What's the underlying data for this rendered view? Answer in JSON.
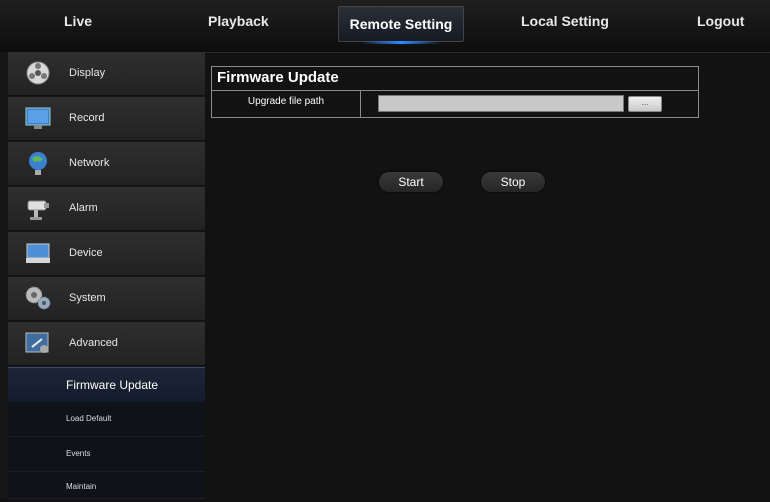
{
  "nav": {
    "live": "Live",
    "playback": "Playback",
    "remote_setting": "Remote Setting",
    "local_setting": "Local Setting",
    "logout": "Logout"
  },
  "sidebar": {
    "items": [
      {
        "label": "Display",
        "icon": "display-icon"
      },
      {
        "label": "Record",
        "icon": "record-icon"
      },
      {
        "label": "Network",
        "icon": "network-icon"
      },
      {
        "label": "Alarm",
        "icon": "alarm-icon"
      },
      {
        "label": "Device",
        "icon": "device-icon"
      },
      {
        "label": "System",
        "icon": "system-icon"
      },
      {
        "label": "Advanced",
        "icon": "advanced-icon"
      }
    ],
    "sub_items": [
      {
        "label": "Firmware Update",
        "active": true
      },
      {
        "label": "Load Default",
        "active": false
      },
      {
        "label": "Events",
        "active": false
      },
      {
        "label": "Maintain",
        "active": false
      }
    ]
  },
  "main": {
    "title": "Firmware Update",
    "row_label": "Upgrade file path",
    "path_value": "",
    "browse_label": "...",
    "start_label": "Start",
    "stop_label": "Stop"
  },
  "colors": {
    "background": "#121212",
    "accent": "#2e8bff",
    "active_sub": "#1c2638"
  }
}
